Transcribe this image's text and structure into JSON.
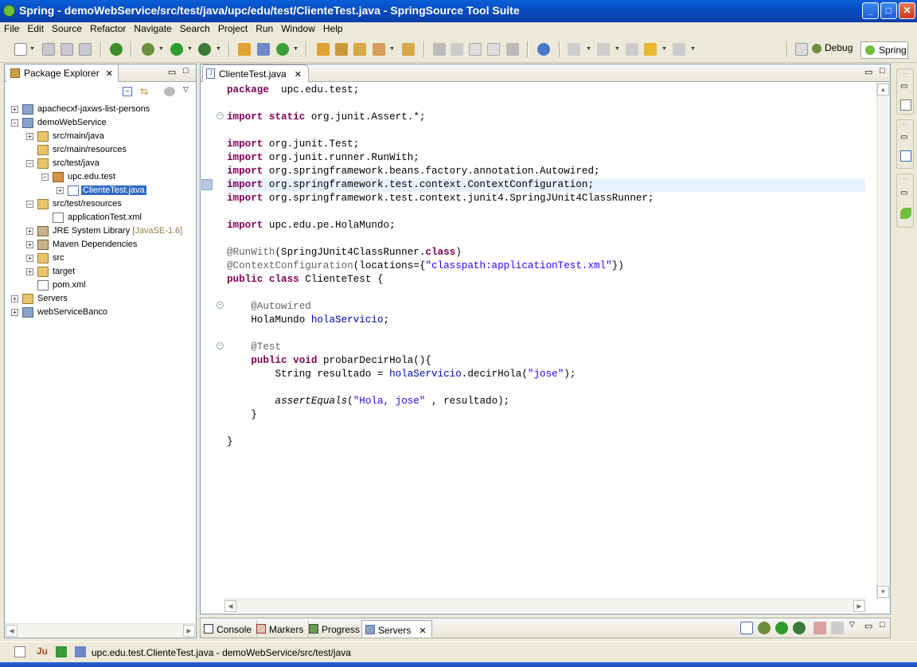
{
  "window": {
    "title": "Spring - demoWebService/src/test/java/upc/edu/test/ClienteTest.java - SpringSource Tool Suite",
    "controls": {
      "minimize": "_",
      "maximize": "□",
      "close": "✕"
    }
  },
  "menu": [
    "File",
    "Edit",
    "Source",
    "Refactor",
    "Navigate",
    "Search",
    "Project",
    "Run",
    "Window",
    "Help"
  ],
  "perspectives": {
    "debug": "Debug",
    "spring": "Spring"
  },
  "package_explorer": {
    "title": "Package Explorer",
    "tree": [
      {
        "label": "apachecxf-jaxws-list-persons",
        "depth": 0,
        "exp": "+",
        "icon": "project"
      },
      {
        "label": "demoWebService",
        "depth": 0,
        "exp": "−",
        "icon": "project"
      },
      {
        "label": "src/main/java",
        "depth": 1,
        "exp": "+",
        "icon": "source-folder"
      },
      {
        "label": "src/main/resources",
        "depth": 1,
        "exp": "",
        "icon": "source-folder"
      },
      {
        "label": "src/test/java",
        "depth": 1,
        "exp": "−",
        "icon": "source-folder"
      },
      {
        "label": "upc.edu.test",
        "depth": 2,
        "exp": "−",
        "icon": "package"
      },
      {
        "label": "ClienteTest.java",
        "depth": 3,
        "exp": "+",
        "icon": "java-file",
        "selected": true
      },
      {
        "label": "src/test/resources",
        "depth": 1,
        "exp": "−",
        "icon": "source-folder"
      },
      {
        "label": "applicationTest.xml",
        "depth": 2,
        "exp": "",
        "icon": "xml-file"
      },
      {
        "label": "JRE System Library",
        "decoration": "[JavaSE-1.6]",
        "depth": 1,
        "exp": "+",
        "icon": "library"
      },
      {
        "label": "Maven Dependencies",
        "depth": 1,
        "exp": "+",
        "icon": "library"
      },
      {
        "label": "src",
        "depth": 1,
        "exp": "+",
        "icon": "folder"
      },
      {
        "label": "target",
        "depth": 1,
        "exp": "+",
        "icon": "folder"
      },
      {
        "label": "pom.xml",
        "depth": 1,
        "exp": "",
        "icon": "maven-file"
      },
      {
        "label": "Servers",
        "depth": 0,
        "exp": "+",
        "icon": "folder"
      },
      {
        "label": "webServiceBanco",
        "depth": 0,
        "exp": "+",
        "icon": "project"
      }
    ]
  },
  "editor": {
    "tab_label": "ClienteTest.java",
    "current_line": 7,
    "lines": [
      [
        [
          "kw",
          "package"
        ],
        [
          "",
          "  upc.edu.test;"
        ]
      ],
      [],
      [
        [
          "kw",
          "import"
        ],
        [
          "",
          " "
        ],
        [
          "kw",
          "static"
        ],
        [
          "",
          " org.junit.Assert.*;"
        ]
      ],
      [],
      [
        [
          "kw",
          "import"
        ],
        [
          "",
          " org.junit.Test;"
        ]
      ],
      [
        [
          "kw",
          "import"
        ],
        [
          "",
          " org.junit.runner.RunWith;"
        ]
      ],
      [
        [
          "kw",
          "import"
        ],
        [
          "",
          " org.springframework.beans.factory.annotation.Autowired;"
        ]
      ],
      [
        [
          "kw",
          "import"
        ],
        [
          "",
          " org.springframework.test.context.ContextConfiguration;"
        ]
      ],
      [
        [
          "kw",
          "import"
        ],
        [
          "",
          " org.springframework.test.context.junit4.SpringJUnit4ClassRunner;"
        ]
      ],
      [],
      [
        [
          "kw",
          "import"
        ],
        [
          "",
          " upc.edu.pe.HolaMundo;"
        ]
      ],
      [],
      [
        [
          "ann",
          "@RunWith"
        ],
        [
          "",
          "(SpringJUnit4ClassRunner."
        ],
        [
          "kw",
          "class"
        ],
        [
          "",
          ")"
        ]
      ],
      [
        [
          "ann",
          "@ContextConfiguration"
        ],
        [
          "",
          "(locations={"
        ],
        [
          "str",
          "\"classpath:applicationTest.xml\""
        ],
        [
          "",
          "})"
        ]
      ],
      [
        [
          "kw",
          "public"
        ],
        [
          "",
          " "
        ],
        [
          "kw",
          "class"
        ],
        [
          "",
          " ClienteTest {"
        ]
      ],
      [],
      [
        [
          "",
          "    "
        ],
        [
          "ann",
          "@Autowired"
        ]
      ],
      [
        [
          "",
          "    HolaMundo "
        ],
        [
          "fld",
          "holaServicio"
        ],
        [
          "",
          ";"
        ]
      ],
      [],
      [
        [
          "",
          "    "
        ],
        [
          "ann",
          "@Test"
        ]
      ],
      [
        [
          "",
          "    "
        ],
        [
          "kw",
          "public"
        ],
        [
          "",
          " "
        ],
        [
          "kw",
          "void"
        ],
        [
          "",
          " probarDecirHola(){"
        ]
      ],
      [
        [
          "",
          "        String resultado = "
        ],
        [
          "fld",
          "holaServicio"
        ],
        [
          "",
          ".decirHola("
        ],
        [
          "str",
          "\"jose\""
        ],
        [
          "",
          ");"
        ]
      ],
      [],
      [
        [
          "",
          "        "
        ],
        [
          "it",
          "assertEquals"
        ],
        [
          "",
          "("
        ],
        [
          "str",
          "\"Hola, jose\""
        ],
        [
          "",
          " , resultado);"
        ]
      ],
      [
        [
          "",
          "    }"
        ]
      ],
      [],
      [
        [
          "",
          "}"
        ]
      ]
    ]
  },
  "bottom_panel": {
    "tabs": [
      "Console",
      "Markers",
      "Progress",
      "Servers"
    ],
    "active": "Servers"
  },
  "status": {
    "text": "upc.edu.test.ClienteTest.java - demoWebService/src/test/java"
  }
}
